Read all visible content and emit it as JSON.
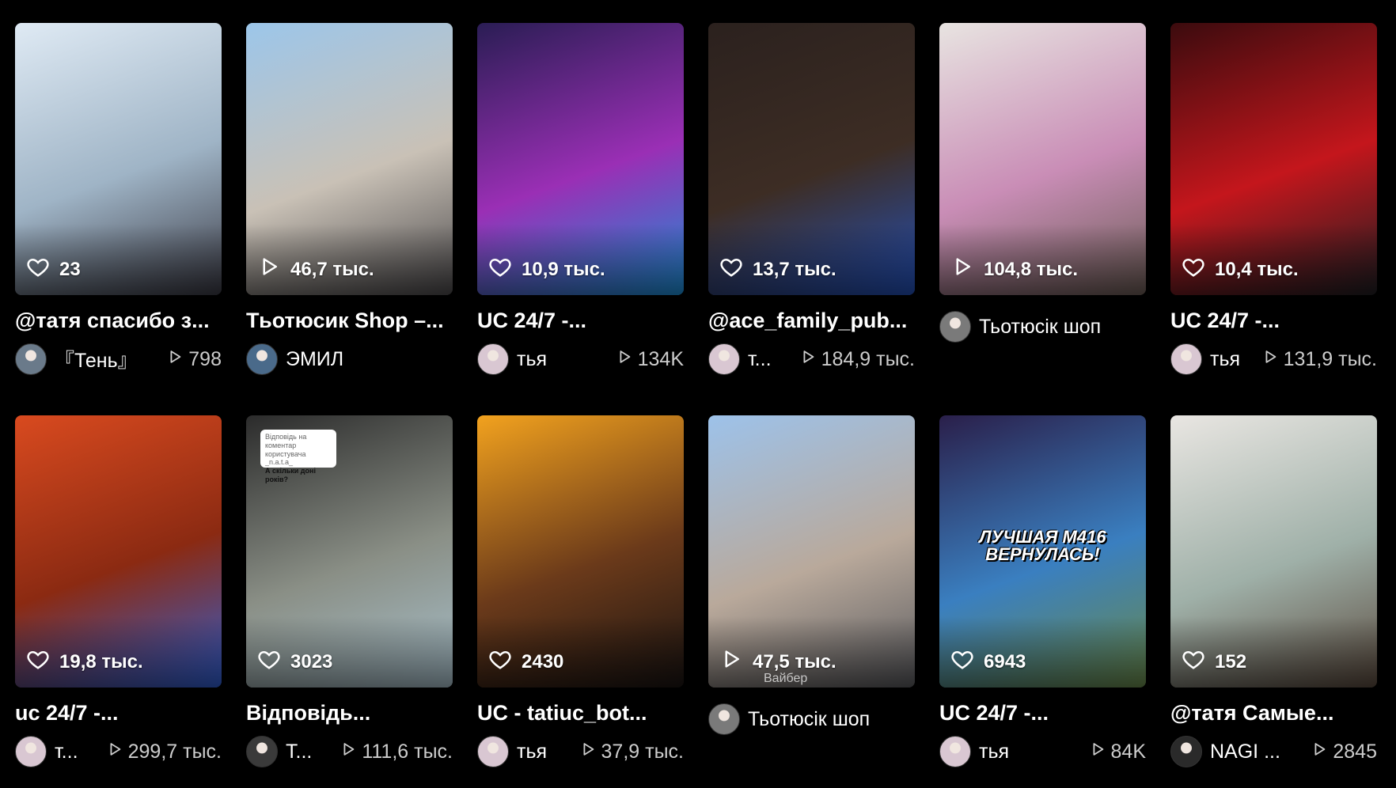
{
  "videos": [
    {
      "metric_icon": "heart-icon",
      "metric": "23",
      "title": "@татя спасибо з...",
      "author": "『Тень』",
      "plays": "798",
      "colors": [
        "#dfeaf4",
        "#9fb4c6",
        "#3a3a44"
      ]
    },
    {
      "metric_icon": "play-icon",
      "metric": "46,7 тыс.",
      "title": "Тьотюсик Shop –...",
      "author": "ЭМИЛ",
      "plays": "",
      "colors": [
        "#9cc6ea",
        "#c9c1b6",
        "#4c4a4c"
      ]
    },
    {
      "metric_icon": "heart-icon",
      "metric": "10,9 тыс.",
      "title": "UC 24/7 -...",
      "author": "тья",
      "plays": "134K",
      "colors": [
        "#2a1d54",
        "#9a2fb5",
        "#1b8fd6"
      ]
    },
    {
      "metric_icon": "heart-icon",
      "metric": "13,7 тыс.",
      "title": "@ace_family_pub...",
      "author": "т...",
      "plays": "184,9 тыс.",
      "colors": [
        "#2b211e",
        "#3d2d24",
        "#2350b8"
      ]
    },
    {
      "metric_icon": "play-icon",
      "metric": "104,8 тыс.",
      "title": "",
      "author": "Тьотюсік шоп",
      "plays": "",
      "colors": [
        "#e8e4e1",
        "#c98db6",
        "#6b5c55"
      ]
    },
    {
      "metric_icon": "heart-icon",
      "metric": "10,4 тыс.",
      "title": "UC 24/7 -...",
      "author": "тья",
      "plays": "131,9 тыс.",
      "colors": [
        "#3b0b0e",
        "#c4161c",
        "#1e1e22"
      ]
    },
    {
      "metric_icon": "heart-icon",
      "metric": "19,8 тыс.",
      "title": "uc 24/7 -...",
      "author": "т...",
      "plays": "299,7 тыс.",
      "colors": [
        "#d94a1f",
        "#8b2a12",
        "#2f5fd4"
      ]
    },
    {
      "metric_icon": "heart-icon",
      "metric": "3023",
      "title": "Відповідь...",
      "author": "Т...",
      "plays": "111,6 тыс.",
      "colors": [
        "#2b2b2b",
        "#8a8f86",
        "#a8c0cb"
      ],
      "caption": {
        "line1": "Відповідь на коментар користувача _n.a.t.a_",
        "line2": "А скільки доні років?"
      }
    },
    {
      "metric_icon": "heart-icon",
      "metric": "2430",
      "title": "UC - tatiuc_bot...",
      "author": "тья",
      "plays": "37,9 тыс.",
      "colors": [
        "#f2a21e",
        "#6b3a1a",
        "#1a1412"
      ]
    },
    {
      "metric_icon": "play-icon",
      "metric": "47,5 тыс.",
      "title": "",
      "author": "Тьотюсік шоп",
      "plays": "",
      "colors": [
        "#9dc2ea",
        "#b9a99b",
        "#595a5e"
      ],
      "watermark": "Вайбер"
    },
    {
      "metric_icon": "heart-icon",
      "metric": "6943",
      "title": "UC 24/7 -...",
      "author": "тья",
      "plays": "84K",
      "colors": [
        "#2a1f4a",
        "#3a7fc0",
        "#6a8a4a"
      ],
      "banner": {
        "line1": "ЛУЧШАЯ М416",
        "line2": "ВЕРНУЛАСЬ!"
      }
    },
    {
      "metric_icon": "heart-icon",
      "metric": "152",
      "title": "@татя Самые...",
      "author": "NAGI ...",
      "plays": "2845",
      "colors": [
        "#e9e6e2",
        "#9fb0a8",
        "#5a4a3e"
      ]
    }
  ],
  "avatar_colors": [
    "#6a7a8a",
    "#4a6a8a",
    "#d9c7d2",
    "#d9c7d2",
    "#7a7a7a",
    "#d9c7d2",
    "#d9c7d2",
    "#3a3a3a",
    "#d9c7d2",
    "#7a7a7a",
    "#d9c7d2",
    "#2a2a2a"
  ]
}
